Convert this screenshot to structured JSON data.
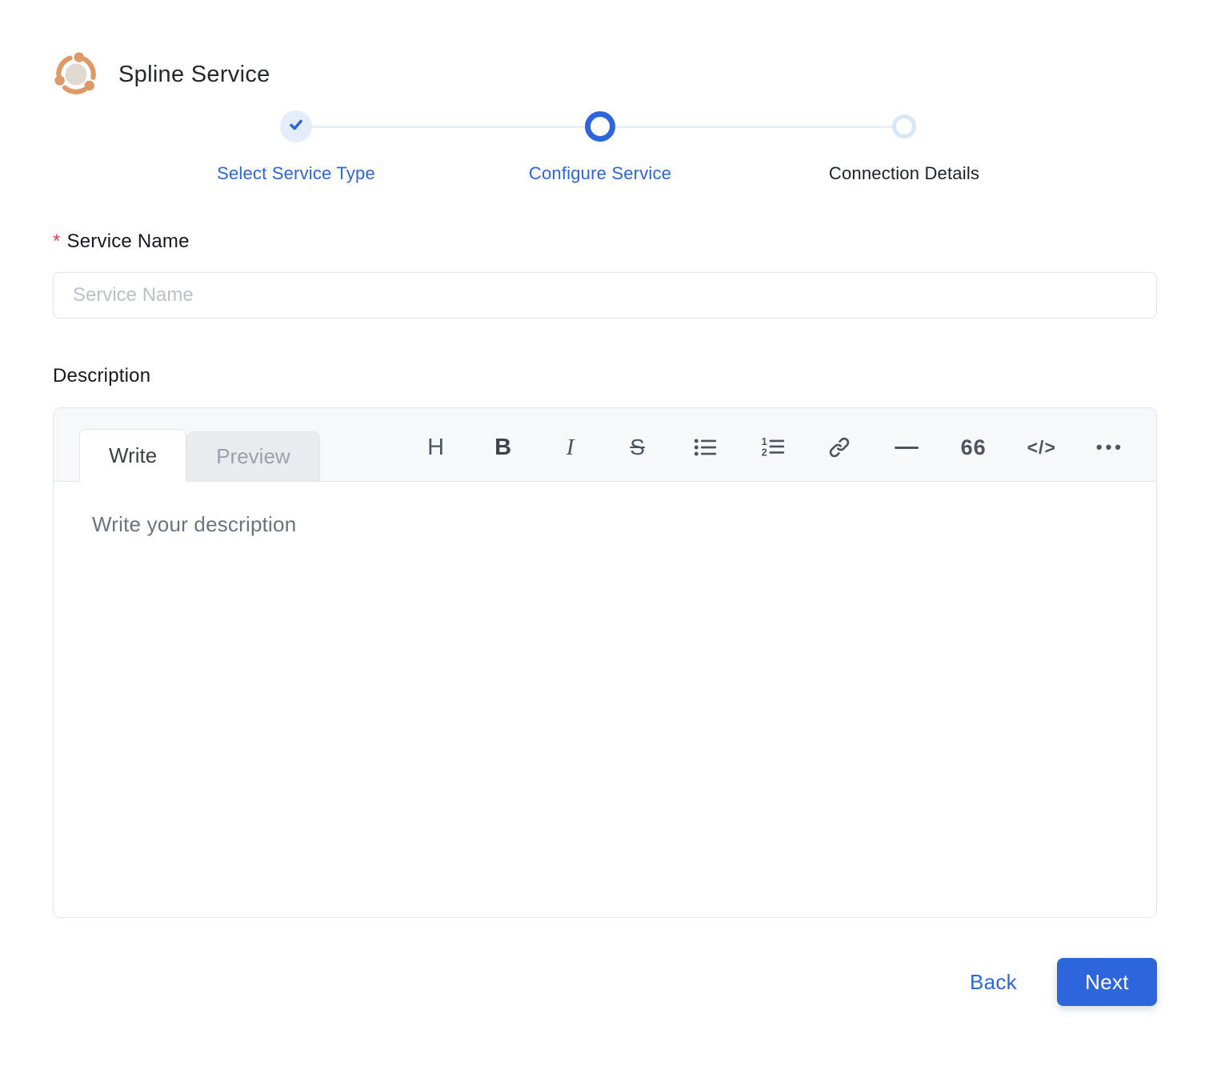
{
  "header": {
    "title": "Spline Service",
    "logo_icon": "spline-network-icon"
  },
  "stepper": {
    "steps": [
      {
        "label": "Select Service Type",
        "state": "completed"
      },
      {
        "label": "Configure Service",
        "state": "active"
      },
      {
        "label": "Connection Details",
        "state": "pending"
      }
    ]
  },
  "form": {
    "service_name": {
      "required_marker": "*",
      "label": "Service Name",
      "placeholder": "Service Name",
      "value": ""
    },
    "description": {
      "label": "Description",
      "tabs": [
        {
          "label": "Write",
          "active": true
        },
        {
          "label": "Preview",
          "active": false
        }
      ],
      "toolbar": [
        {
          "name": "heading-icon",
          "glyph": "H"
        },
        {
          "name": "bold-icon",
          "glyph": "B"
        },
        {
          "name": "italic-icon",
          "glyph": "I"
        },
        {
          "name": "strikethrough-icon",
          "glyph": "S"
        },
        {
          "name": "unordered-list-icon",
          "glyph": ""
        },
        {
          "name": "ordered-list-icon",
          "glyph": ""
        },
        {
          "name": "link-icon",
          "glyph": ""
        },
        {
          "name": "horizontal-rule-icon",
          "glyph": ""
        },
        {
          "name": "quote-icon",
          "glyph": "66"
        },
        {
          "name": "code-icon",
          "glyph": "</>"
        },
        {
          "name": "more-icon",
          "glyph": "•••"
        }
      ],
      "placeholder": "Write your description",
      "value": ""
    }
  },
  "footer": {
    "back_label": "Back",
    "next_label": "Next"
  },
  "colors": {
    "accent_blue": "#2d65dc",
    "light_blue_track": "#e8effb",
    "completed_circle_bg": "#e3edfb",
    "pending_ring": "#d9e6f8",
    "logo_orange": "#dd9a68",
    "required_red": "#e5484d",
    "editor_header_bg": "#f6f8fa",
    "border_gray": "#e2e5ea"
  }
}
